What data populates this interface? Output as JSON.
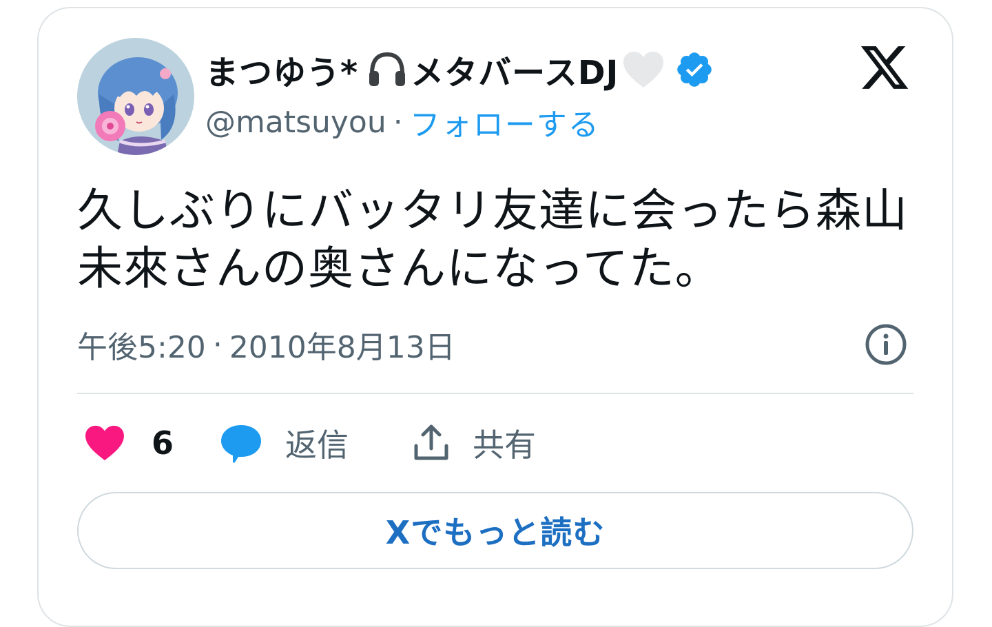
{
  "user": {
    "display_name": "まつゆう*",
    "display_name_suffix": "メタバースDJ",
    "handle": "@matsuyou",
    "separator": "·",
    "follow_label": "フォローする",
    "headphones_emoji": "headphones-icon",
    "heart_emoji": "white-heart-icon",
    "verified_icon": "verified-badge-icon"
  },
  "tweet": {
    "text": "久しぶりにバッタリ友達に会ったら森山未來さんの奥さんになってた。",
    "time": "午後5:20",
    "separator": "·",
    "date": "2010年8月13日"
  },
  "actions": {
    "like_count": "6",
    "reply_label": "返信",
    "share_label": "共有"
  },
  "read_more_label": "Xでもっと読む",
  "colors": {
    "accent": "#1d9bf0",
    "like": "#f91880",
    "text": "#0f1419",
    "muted": "#536471",
    "border": "#dfe3e6"
  }
}
